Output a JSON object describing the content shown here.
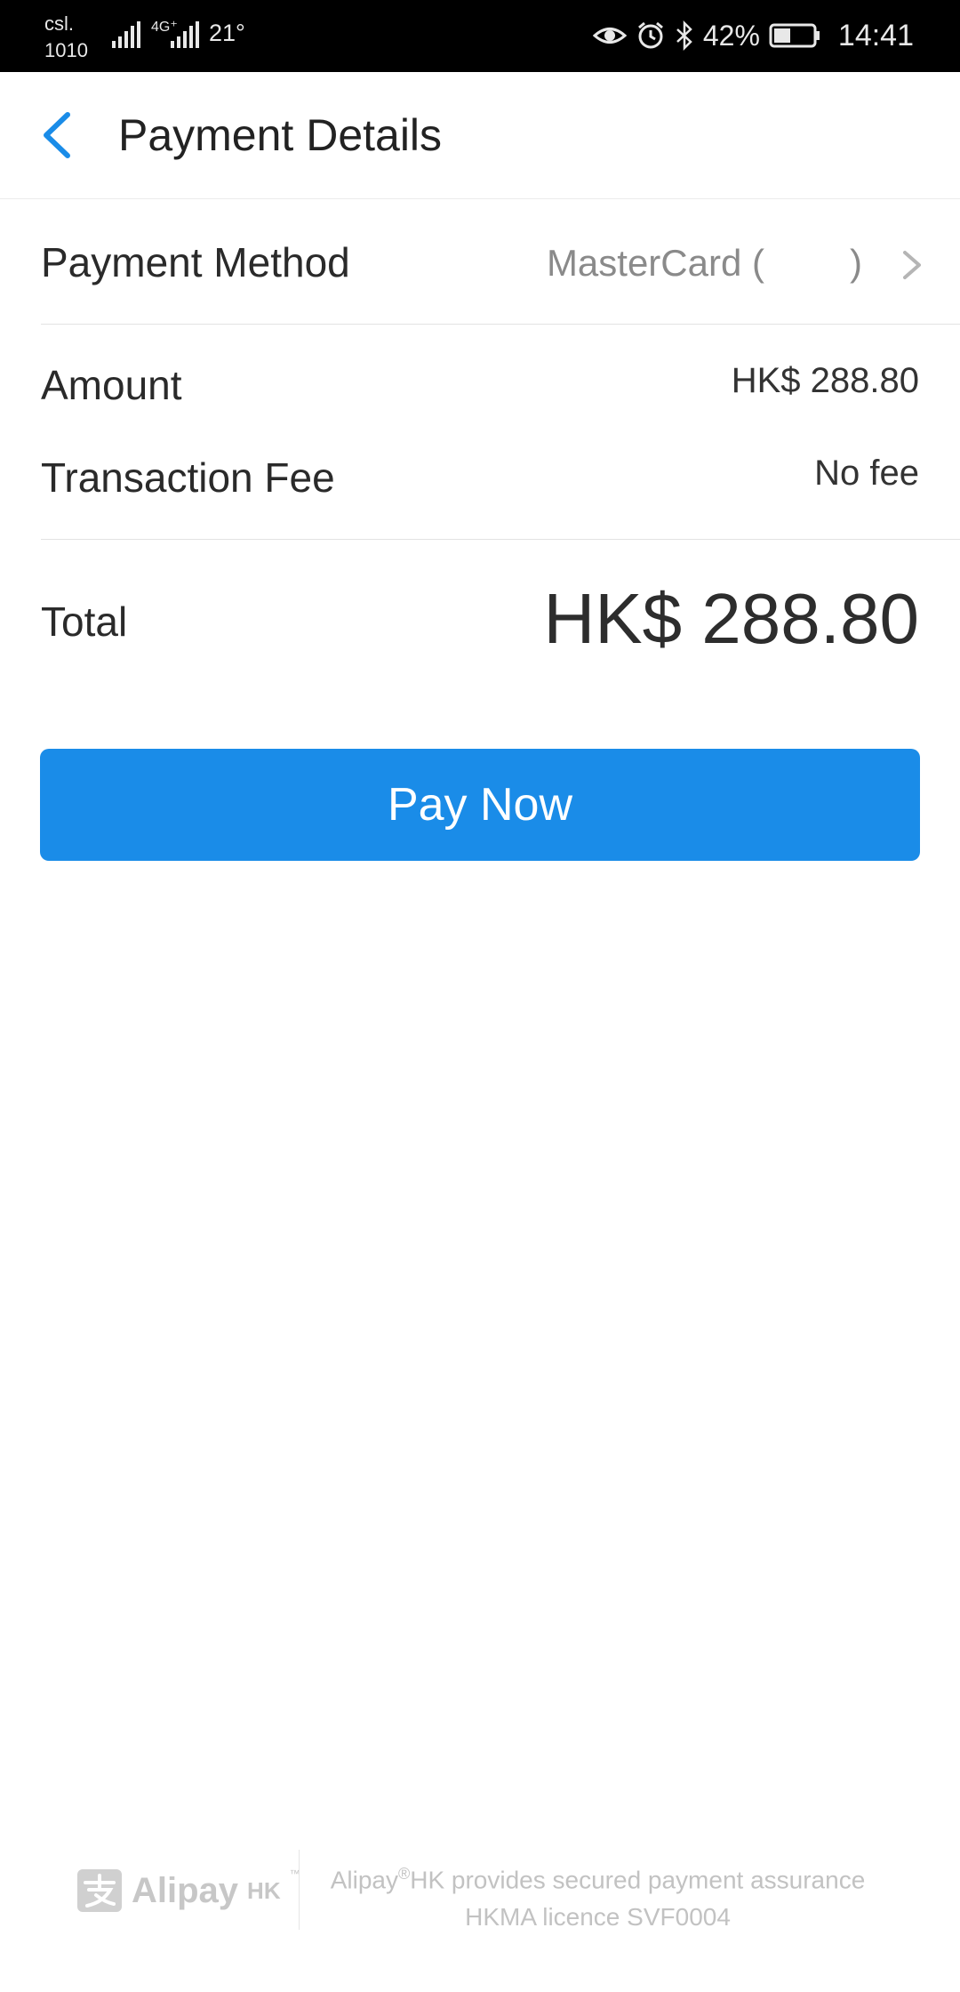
{
  "status_bar": {
    "carrier_line1": "csl.",
    "carrier_line2": "1010",
    "network": "4G⁺",
    "temperature": "21°",
    "battery_percent": "42%",
    "time": "14:41",
    "icons": [
      "signal-icon",
      "signal-4g-icon",
      "eye-icon",
      "alarm-icon",
      "bluetooth-icon",
      "battery-icon"
    ]
  },
  "header": {
    "title": "Payment Details",
    "back_icon": "chevron-left-icon",
    "accent_color": "#1a8ce8"
  },
  "payment": {
    "method_label": "Payment Method",
    "method_value_prefix": "MasterCard (",
    "method_value_suffix": ")",
    "amount_label": "Amount",
    "amount_value": "HK$ 288.80",
    "fee_label": "Transaction Fee",
    "fee_value": "No fee",
    "total_label": "Total",
    "total_value": "HK$ 288.80"
  },
  "actions": {
    "pay_now_label": "Pay Now",
    "pay_now_color": "#1a8ce8"
  },
  "footer": {
    "logo_text": "Alipay",
    "logo_sub": "HK",
    "logo_tm": "™",
    "assurance_prefix": "Alipay",
    "assurance_reg": "®",
    "assurance_rest": "HK provides secured payment assurance",
    "licence": "HKMA licence SVF0004"
  }
}
